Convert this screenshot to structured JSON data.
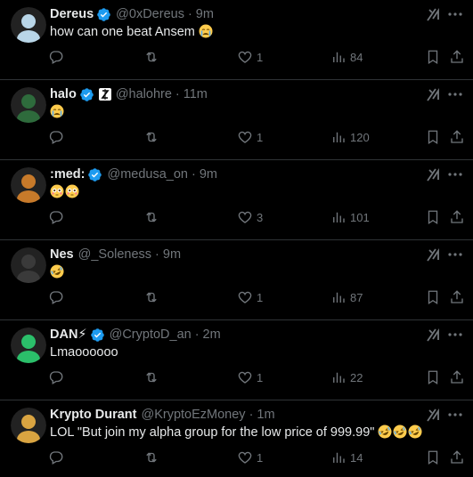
{
  "tweets": [
    {
      "name": "Dereus",
      "handle": "@0xDereus",
      "time": "9m",
      "text": "how can one beat Ansem",
      "emojis": [
        "crying"
      ],
      "likes": "1",
      "views": "84",
      "verified": true,
      "affiliate": false,
      "accent": "#b9d6e8"
    },
    {
      "name": "halo",
      "handle": "@halohre",
      "time": "11m",
      "text": "",
      "emojis": [
        "crying"
      ],
      "likes": "1",
      "views": "120",
      "verified": true,
      "affiliate": true,
      "accent": "#2e6b3c"
    },
    {
      "name": ":med:",
      "handle": "@medusa_on",
      "time": "9m",
      "text": "",
      "emojis": [
        "flushed",
        "flushed"
      ],
      "likes": "3",
      "views": "101",
      "verified": true,
      "affiliate": false,
      "accent": "#c77a2a"
    },
    {
      "name": "Nes",
      "handle": "@_Soleness",
      "time": "9m",
      "text": "",
      "emojis": [
        "rofl"
      ],
      "likes": "1",
      "views": "87",
      "verified": false,
      "affiliate": false,
      "accent": "#3a3a3a"
    },
    {
      "name": "DAN⚡",
      "handle": "@CryptoD_an",
      "time": "2m",
      "text": "Lmaoooooo",
      "emojis": [],
      "likes": "1",
      "views": "22",
      "verified": true,
      "affiliate": false,
      "accent": "#2bbf6a"
    },
    {
      "name": "Krypto Durant",
      "handle": "@KryptoEzMoney",
      "time": "1m",
      "text": "LOL \"But join my alpha group for the low price of 999.99\"",
      "emojis": [
        "rofl",
        "rofl",
        "rofl"
      ],
      "likes": "1",
      "views": "14",
      "verified": false,
      "affiliate": false,
      "accent": "#d9a441"
    }
  ],
  "icons": {
    "reply": "reply-icon",
    "repost": "repost-icon",
    "like": "heart-icon",
    "views": "views-icon",
    "bookmark": "bookmark-icon",
    "share": "share-icon",
    "grok": "grok-icon",
    "more": "more-icon",
    "verified": "verified-badge-icon"
  },
  "colors": {
    "background": "#000000",
    "text": "#e7e9ea",
    "muted": "#71767b",
    "divider": "#2f3336",
    "verified": "#1d9bf0"
  }
}
